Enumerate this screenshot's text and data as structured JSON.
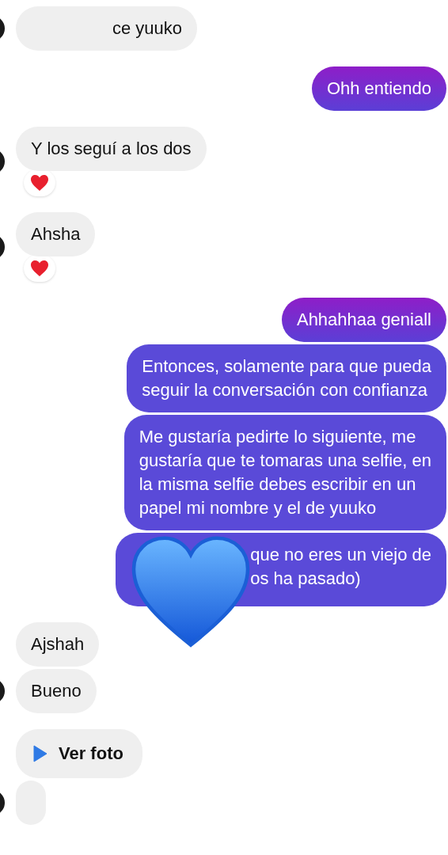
{
  "messages": [
    {
      "kind": "in",
      "avatar": true,
      "start_hidden": true,
      "lines": [
        "ce yuuko"
      ]
    },
    {
      "kind": "out",
      "lines": [
        "Ohh entiendo"
      ]
    },
    {
      "kind": "in",
      "avatar": true,
      "lines": [
        "Y los seguí a los dos"
      ],
      "reaction": true
    },
    {
      "kind": "in",
      "avatar": true,
      "lines": [
        "Ahsha"
      ],
      "reaction": true
    },
    {
      "kind": "out",
      "lines": [
        "Ahhahhaa geniall"
      ]
    },
    {
      "kind": "out",
      "lines": [
        "Entonces, solamente para que pueda",
        "seguir la conversación con confianza"
      ]
    },
    {
      "kind": "out",
      "lines": [
        "Me gustaría pedirte lo siguiente, me",
        "gustaría que te tomaras una selfie, en",
        "la misma selfie debes escribir en un",
        "papel mi nombre y el de yuuko"
      ]
    },
    {
      "kind": "out",
      "start_hidden": true,
      "lines": [
        "que no eres un viejo de",
        "os ha pasado)"
      ],
      "sticker": true
    },
    {
      "kind": "in",
      "lines": [
        "Ajshah"
      ]
    },
    {
      "kind": "in",
      "avatar": true,
      "lines": [
        "Bueno"
      ]
    },
    {
      "kind": "photo",
      "lines": [
        "Ver foto"
      ]
    },
    {
      "kind": "in",
      "avatar": true
    }
  ]
}
